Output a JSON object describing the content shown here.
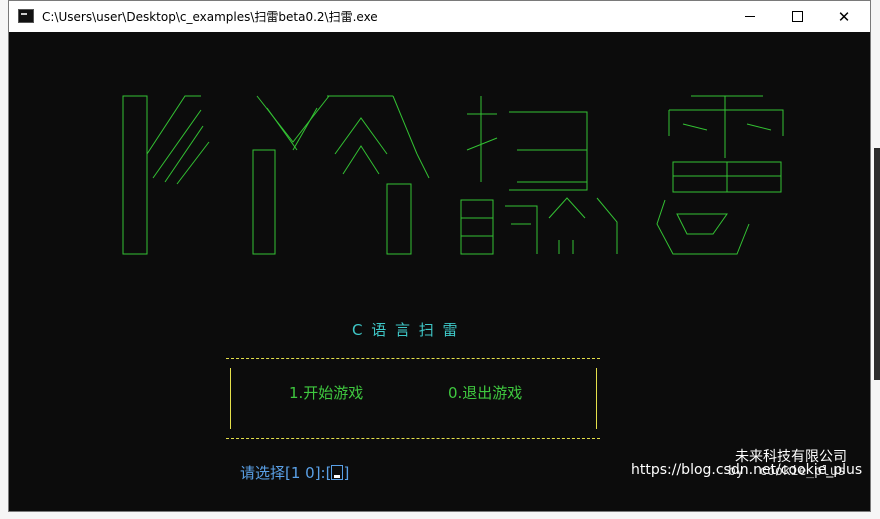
{
  "window": {
    "title": "C:\\Users\\user\\Desktop\\c_examples\\扫雷beta0.2\\扫雷.exe",
    "minimize_label": "",
    "maximize_label": "",
    "close_label": "✕"
  },
  "console": {
    "subtitle": "C 语 言 扫 雷",
    "menu": {
      "start": "1.开始游戏",
      "quit": "0.退出游戏"
    },
    "prompt_label": "请选择[1 0]:[",
    "prompt_close": "]",
    "author": "by  cookie_plus"
  },
  "watermark": {
    "company": "未来科技有限公司",
    "url": "https://blog.csdn.net/cookie_plus"
  },
  "colors": {
    "logo_green": "#33c233",
    "subtitle_cyan": "#3fc8c8",
    "menu_yellow": "#e5e04a",
    "menu_green": "#3fc83f",
    "prompt_blue": "#5aa0e6"
  }
}
